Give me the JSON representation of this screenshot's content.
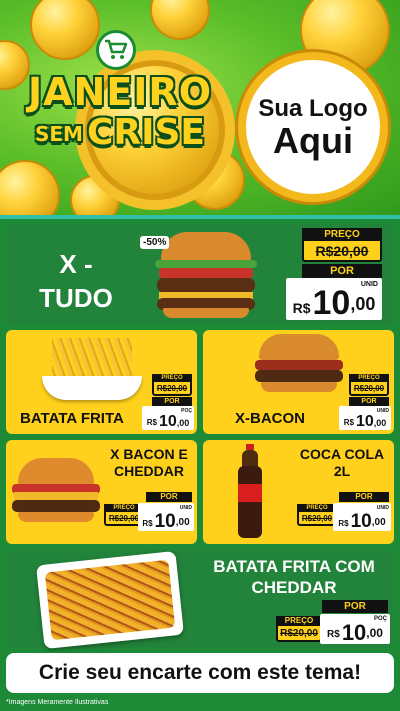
{
  "header": {
    "title_line1": "JANEIRO",
    "title_sem": "SEM",
    "title_line2": "CRISE",
    "logo_line1": "Sua Logo",
    "logo_line2": "Aqui"
  },
  "featured": {
    "name": "X - TUDO",
    "discount": "-50%",
    "price_label": "PREÇO",
    "old_price": "R$20,00",
    "por_label": "POR",
    "currency": "R$",
    "new_int": "10",
    "new_dec": ",00",
    "unit": "UNID"
  },
  "items": [
    {
      "name": "BATATA FRITA",
      "price_label": "PREÇO",
      "old_price": "R$20,00",
      "por_label": "POR",
      "currency": "R$",
      "new_int": "10",
      "new_dec": ",00",
      "unit": "POÇ"
    },
    {
      "name": "X-BACON",
      "price_label": "PREÇO",
      "old_price": "R$20,00",
      "por_label": "POR",
      "currency": "R$",
      "new_int": "10",
      "new_dec": ",00",
      "unit": "UNID"
    },
    {
      "name": "X BACON E CHEDDAR",
      "price_label": "PREÇO",
      "old_price": "R$20,00",
      "por_label": "POR",
      "currency": "R$",
      "new_int": "10",
      "new_dec": ",00",
      "unit": "UNID"
    },
    {
      "name": "COCA COLA 2L",
      "price_label": "PREÇO",
      "old_price": "R$20,00",
      "por_label": "POR",
      "currency": "R$",
      "new_int": "10",
      "new_dec": ",00",
      "unit": "UNID"
    }
  ],
  "bottom_item": {
    "name": "BATATA FRITA COM CHEDDAR",
    "price_label": "PREÇO",
    "old_price": "R$20,00",
    "por_label": "POR",
    "currency": "R$",
    "new_int": "10",
    "new_dec": ",00",
    "unit": "POÇ"
  },
  "cta": "Crie seu encarte com este tema!",
  "footnote": "*Imagens Meramente Ilustrativas",
  "colors": {
    "green": "#22833a",
    "yellow": "#ffd11c",
    "black": "#111111"
  },
  "icons": [
    "shopping-cart-icon",
    "coin-icon"
  ]
}
